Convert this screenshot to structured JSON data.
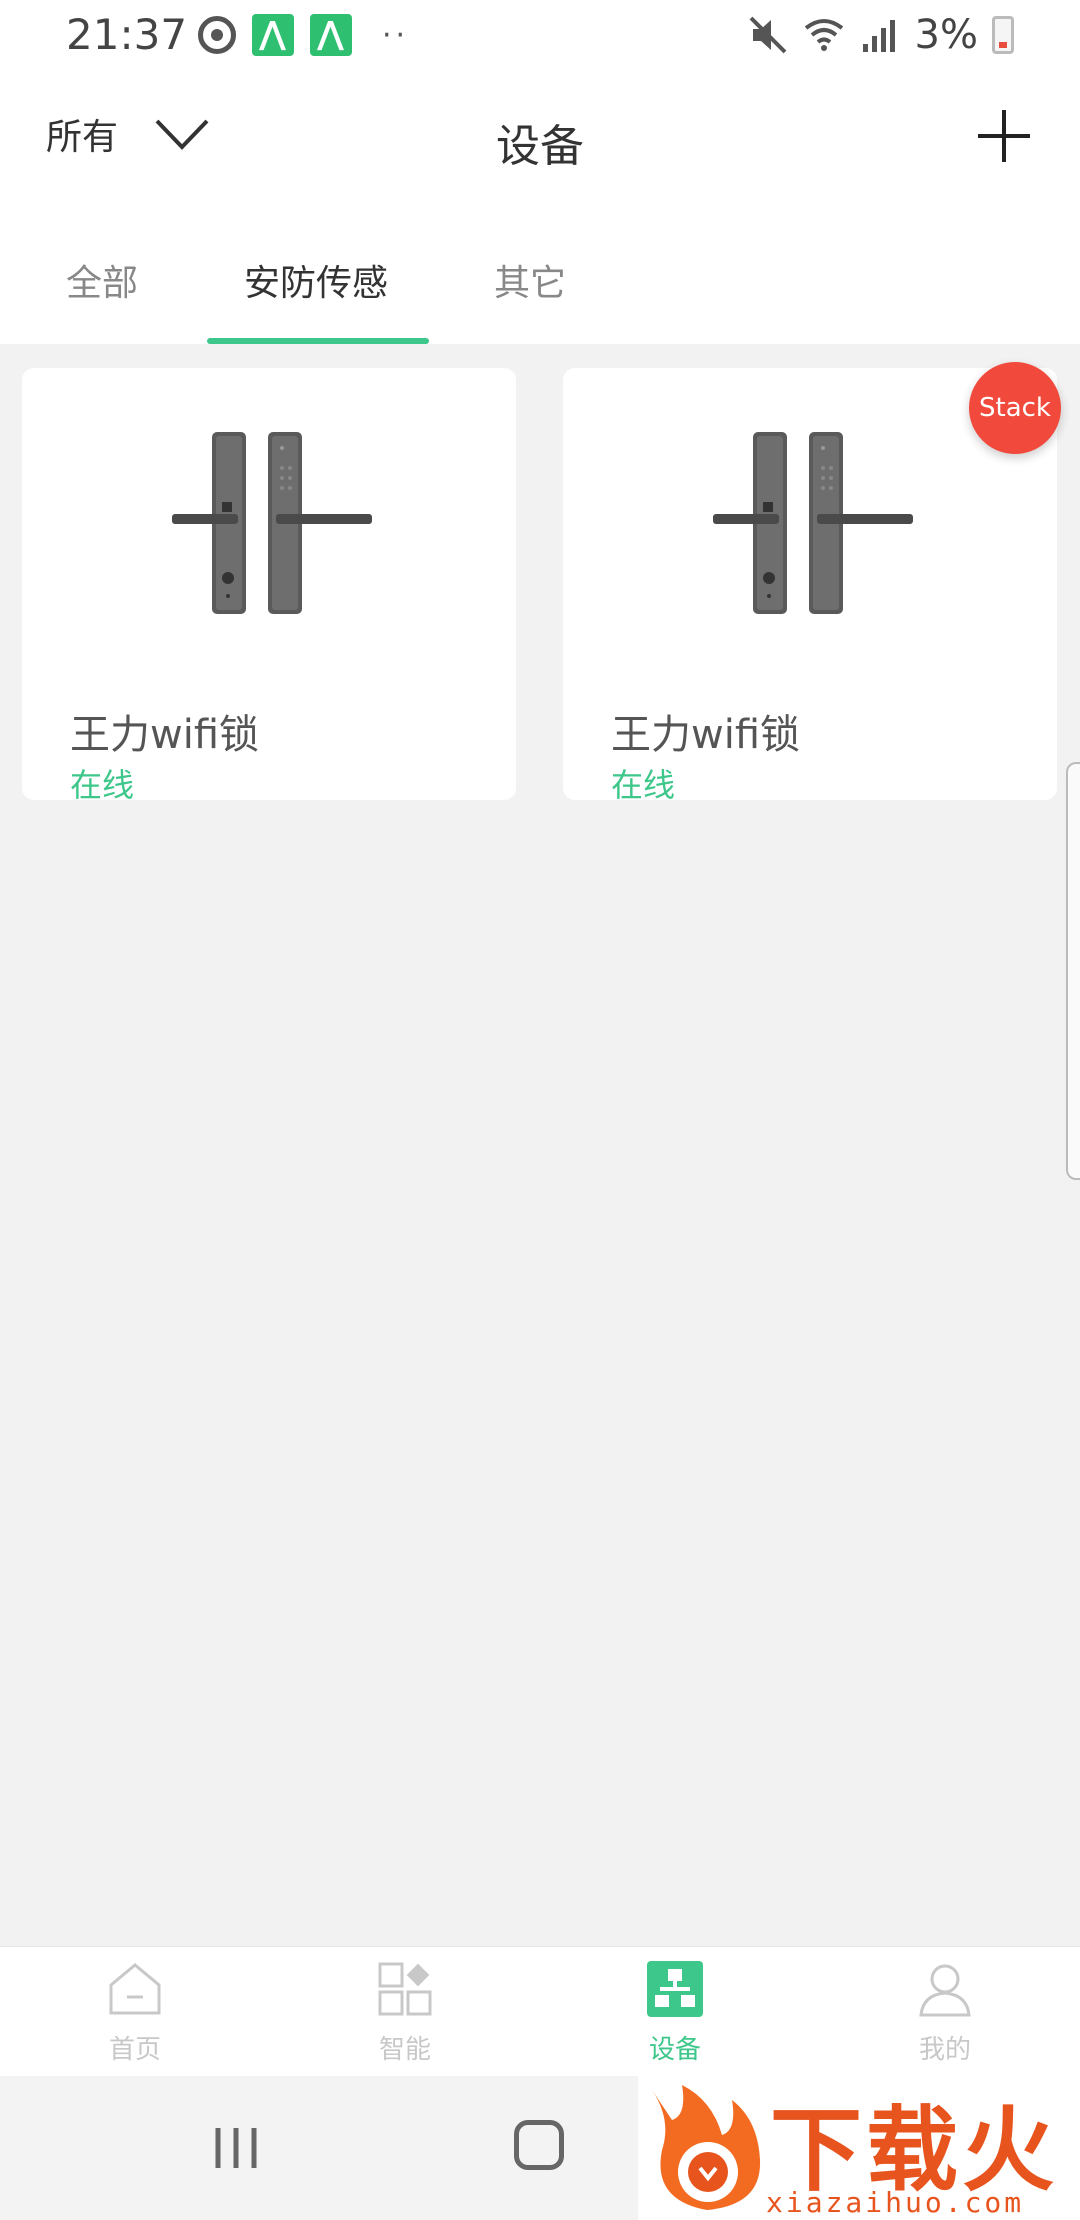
{
  "status_bar": {
    "time": "21:37",
    "battery_percent": "3%",
    "icons": [
      "sync-icon",
      "app-notification-icon",
      "app-notification-icon",
      "more-dots-icon",
      "mute-icon",
      "wifi-icon",
      "signal-icon",
      "battery-low-icon"
    ]
  },
  "header": {
    "filter_label": "所有",
    "title": "设备"
  },
  "tabs": [
    {
      "label": "全部",
      "active": false
    },
    {
      "label": "安防传感",
      "active": true
    },
    {
      "label": "其它",
      "active": false
    }
  ],
  "devices": [
    {
      "name": "王力wifi锁",
      "status": "在线",
      "badge": ""
    },
    {
      "name": "王力wifi锁",
      "status": "在线",
      "badge": "Stack"
    }
  ],
  "bottom_nav": [
    {
      "label": "首页",
      "icon": "home-icon",
      "active": false
    },
    {
      "label": "智能",
      "icon": "smart-icon",
      "active": false
    },
    {
      "label": "设备",
      "icon": "devices-icon",
      "active": true
    },
    {
      "label": "我的",
      "icon": "profile-icon",
      "active": false
    }
  ],
  "watermark": {
    "title": "下载火",
    "url": "xiazaihuo.com"
  },
  "colors": {
    "accent": "#3ec78a",
    "badge": "#f14a3c",
    "background": "#f2f2f2"
  }
}
